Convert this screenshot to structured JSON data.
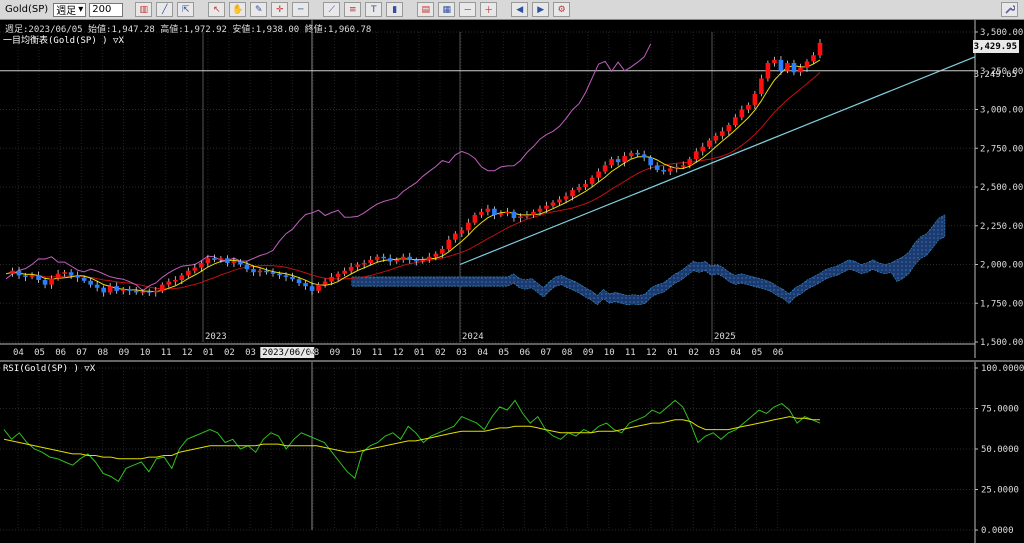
{
  "toolbar": {
    "symbol": "Gold(SP)",
    "timeframe": "週足",
    "bar_count": "200",
    "icons": [
      "candle-chart-icon",
      "line-chart-icon",
      "cursor-icon",
      "pointer-icon",
      "hand-icon",
      "pencil-icon",
      "crosshair-icon",
      "horizontal-line-icon",
      "trendline-icon",
      "fibonacci-icon",
      "text-icon",
      "bar-chart-icon",
      "compress-icon",
      "expand-icon",
      "zoom-out-icon",
      "zoom-in-icon",
      "scroll-left-icon",
      "scroll-right-icon",
      "settings-icon"
    ],
    "right_icon": "wrench-icon"
  },
  "main": {
    "info_line": "週足:2023/06/05 始値:1,947.28 高値:1,972.92 安値:1,938.00 終値:1,960.78",
    "indicator_label": "一目均衡表(Gold(SP) ) ▽X",
    "price_labels": [
      "3,500.00",
      "3,250.00",
      "3,000.00",
      "2,750.00",
      "2,500.00",
      "2,250.00",
      "2,000.00",
      "1,750.00",
      "1,500.00"
    ],
    "current_price": "3,429.95",
    "hline_price": "3,249.65",
    "month_labels": [
      "04",
      "05",
      "06",
      "07",
      "08",
      "09",
      "10",
      "11",
      "12",
      "01",
      "02",
      "03",
      "04",
      "2023/06/04",
      "08",
      "09",
      "10",
      "11",
      "12",
      "01",
      "02",
      "03",
      "04",
      "05",
      "06",
      "07",
      "08",
      "09",
      "10",
      "11",
      "12",
      "01",
      "02",
      "03",
      "04",
      "05",
      "06"
    ],
    "year_labels": [
      "2023",
      "2024",
      "2025"
    ]
  },
  "rsi": {
    "label": "RSI(Gold(SP) ) ▽X",
    "levels": [
      "100.0000",
      "75.0000",
      "50.0000",
      "25.0000",
      "0.0000"
    ]
  },
  "colors": {
    "up": "#ff1010",
    "down": "#2a7fff",
    "tenkan": "#e8e000",
    "kijun": "#c01010",
    "chikou": "#c060c0",
    "trendline": "#80d0e0",
    "cloud": "#1a3a70",
    "rsi": "#30c020",
    "rsi_signal": "#e0e000"
  },
  "chart_data": [
    {
      "type": "candlestick",
      "title": "",
      "ylim": [
        1500,
        3500
      ],
      "y_ticks": [
        3500,
        3250,
        3000,
        2750,
        2500,
        2250,
        2000,
        1750,
        1500
      ],
      "close_path": [
        1940,
        1960,
        1930,
        1920,
        1930,
        1900,
        1870,
        1910,
        1940,
        1950,
        1930,
        1915,
        1895,
        1870,
        1850,
        1820,
        1860,
        1830,
        1840,
        1830,
        1820,
        1825,
        1820,
        1830,
        1870,
        1890,
        1900,
        1930,
        1960,
        1980,
        2010,
        2040,
        2030,
        2040,
        2010,
        2020,
        2000,
        1970,
        1950,
        1960,
        1950,
        1940,
        1930,
        1920,
        1905,
        1880,
        1860,
        1830,
        1870,
        1890,
        1920,
        1940,
        1960,
        1985,
        2000,
        2010,
        2030,
        2050,
        2040,
        2020,
        2030,
        2050,
        2030,
        2020,
        2030,
        2050,
        2070,
        2100,
        2160,
        2200,
        2220,
        2270,
        2320,
        2340,
        2360,
        2320,
        2330,
        2340,
        2300,
        2310,
        2320,
        2340,
        2360,
        2380,
        2400,
        2420,
        2440,
        2480,
        2500,
        2520,
        2560,
        2600,
        2640,
        2680,
        2660,
        2700,
        2720,
        2710,
        2690,
        2640,
        2610,
        2600,
        2620,
        2630,
        2640,
        2680,
        2730,
        2760,
        2800,
        2830,
        2860,
        2900,
        2950,
        3000,
        3030,
        3100,
        3200,
        3300,
        3320,
        3250,
        3300,
        3240,
        3270,
        3310,
        3350,
        3430
      ],
      "current_price": 3429.95,
      "horizontal_line": 3249.65
    },
    {
      "type": "line",
      "title": "",
      "ylim": [
        0,
        100
      ],
      "y_ticks": [
        100,
        75,
        50,
        25,
        0
      ],
      "series": [
        {
          "values": [
            62,
            56,
            60,
            54,
            50,
            48,
            45,
            44,
            42,
            40,
            44,
            47,
            42,
            35,
            33,
            30,
            38,
            40,
            42,
            36,
            44,
            45,
            38,
            50,
            56,
            58,
            60,
            62,
            60,
            54,
            56,
            50,
            52,
            48,
            56,
            60,
            58,
            50,
            56,
            60,
            58,
            56,
            54,
            48,
            42,
            36,
            32,
            48,
            52,
            54,
            58,
            60,
            56,
            64,
            60,
            54,
            58,
            60,
            62,
            64,
            70,
            68,
            66,
            62,
            70,
            76,
            74,
            80,
            72,
            66,
            70,
            62,
            58,
            56,
            60,
            58,
            62,
            60,
            64,
            66,
            62,
            60,
            66,
            68,
            70,
            74,
            72,
            76,
            80,
            76,
            66,
            54,
            58,
            60,
            56,
            60,
            62,
            66,
            70,
            74,
            72,
            76,
            78,
            74,
            66,
            70,
            68,
            66
          ]
        },
        {
          "values": [
            56,
            55,
            54,
            53,
            52,
            51,
            50,
            49,
            48,
            47,
            47,
            46,
            46,
            45,
            45,
            44,
            44,
            44,
            44,
            45,
            45,
            46,
            46,
            48,
            49,
            50,
            51,
            52,
            52,
            52,
            52,
            52,
            52,
            52,
            53,
            53,
            53,
            52,
            52,
            52,
            52,
            52,
            51,
            50,
            49,
            48,
            48,
            49,
            50,
            51,
            52,
            53,
            54,
            55,
            55,
            56,
            57,
            58,
            59,
            60,
            61,
            61,
            61,
            61,
            62,
            63,
            63,
            64,
            64,
            64,
            63,
            62,
            61,
            60,
            60,
            60,
            60,
            60,
            61,
            61,
            61,
            62,
            63,
            64,
            65,
            66,
            66,
            67,
            68,
            68,
            67,
            64,
            62,
            62,
            62,
            62,
            63,
            64,
            65,
            66,
            67,
            68,
            69,
            70,
            69,
            69,
            68,
            68
          ]
        }
      ]
    }
  ]
}
